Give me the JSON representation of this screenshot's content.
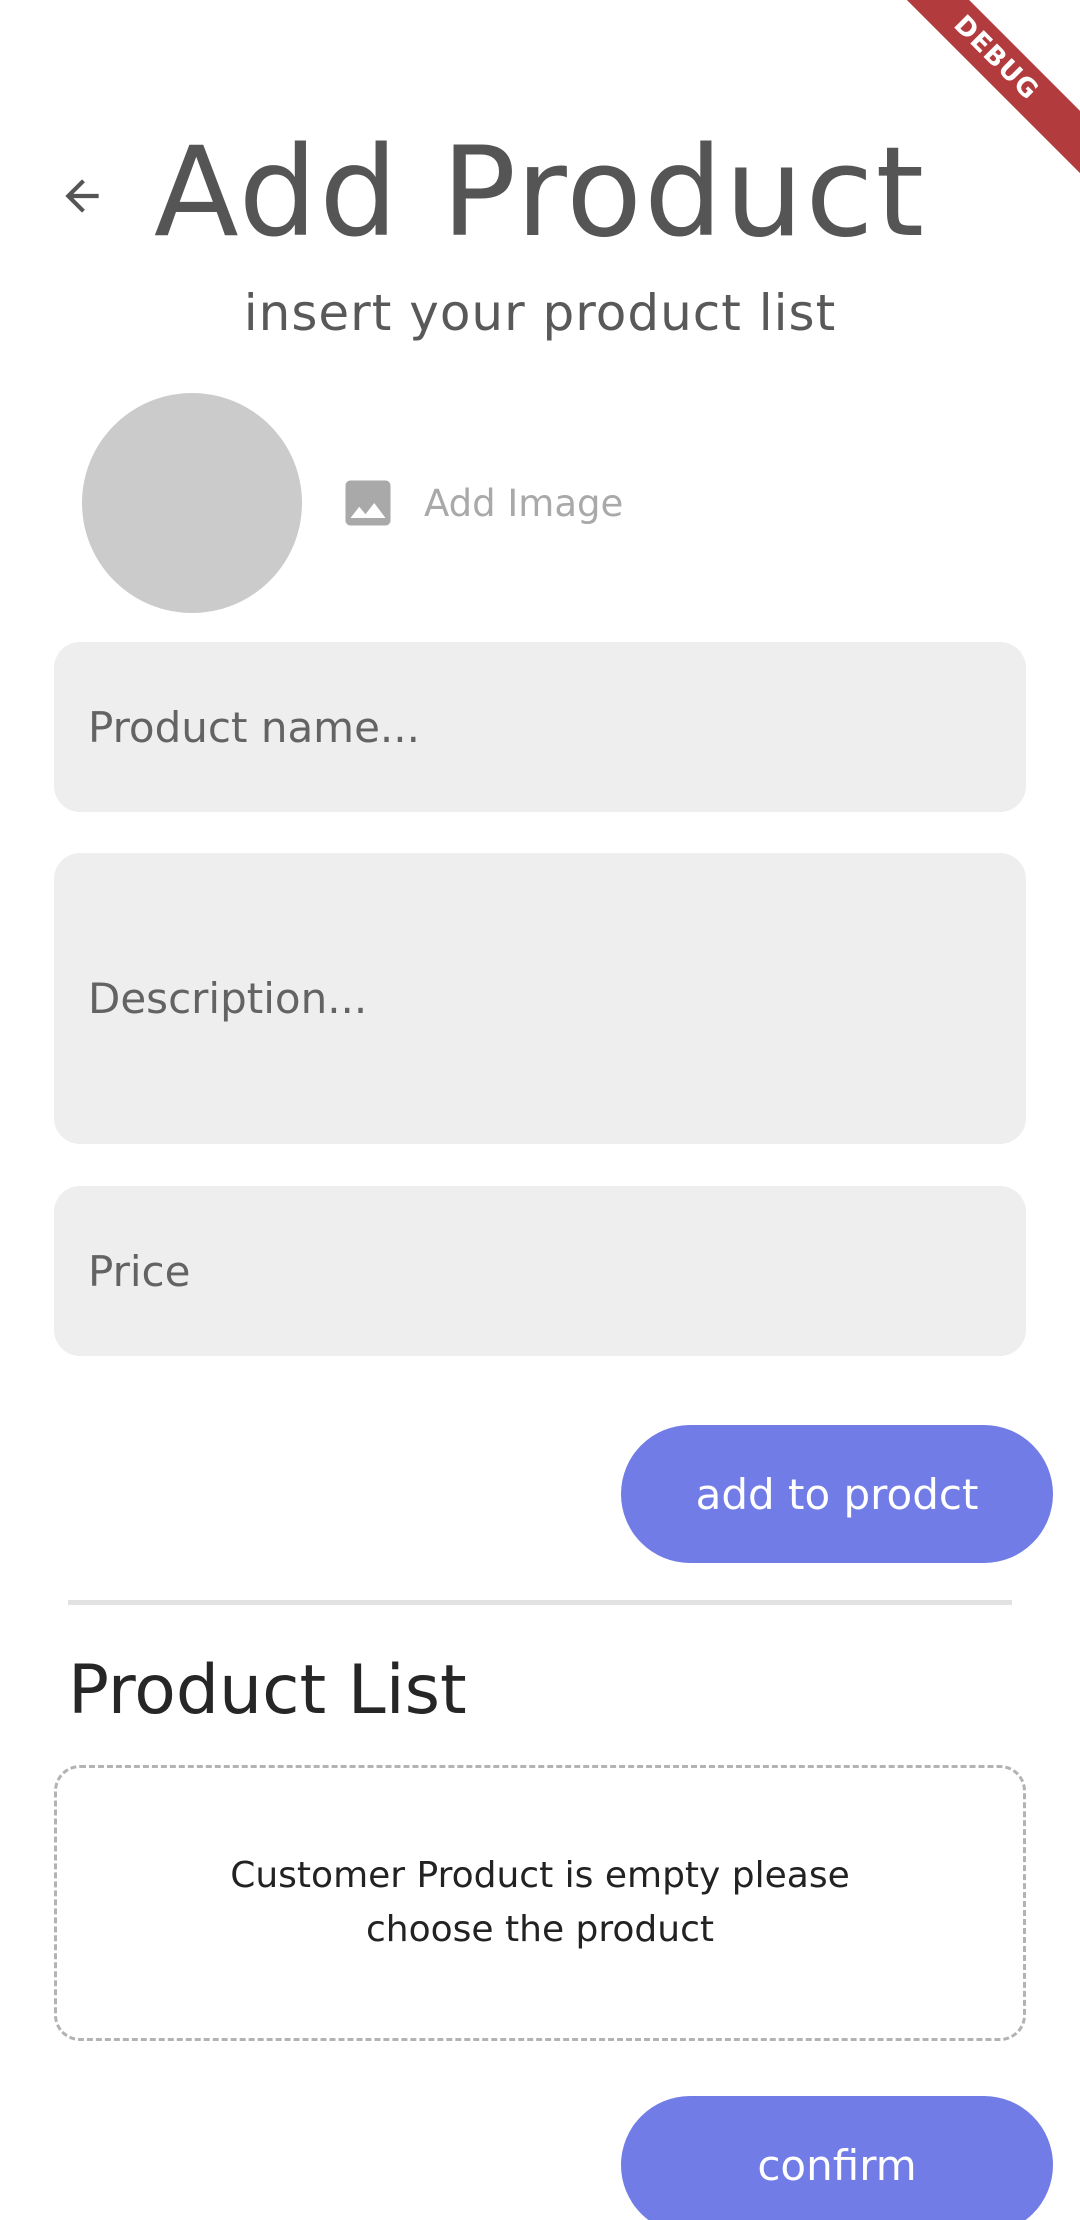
{
  "header": {
    "title": "Add Product",
    "subtitle": "insert your product list"
  },
  "image_picker": {
    "label": "Add Image"
  },
  "form": {
    "name_placeholder": "Product name...",
    "description_placeholder": "Description...",
    "price_placeholder": "Price"
  },
  "actions": {
    "add_label": "add to prodct",
    "confirm_label": "confirm"
  },
  "product_list": {
    "title": "Product List",
    "empty_message": "Customer Product is empty please choose the product"
  },
  "debug_banner": "DEBUG",
  "colors": {
    "accent": "#717ce6",
    "field_bg": "#eeeeee",
    "avatar": "#cbcbcb",
    "debug": "#b23b3e"
  }
}
